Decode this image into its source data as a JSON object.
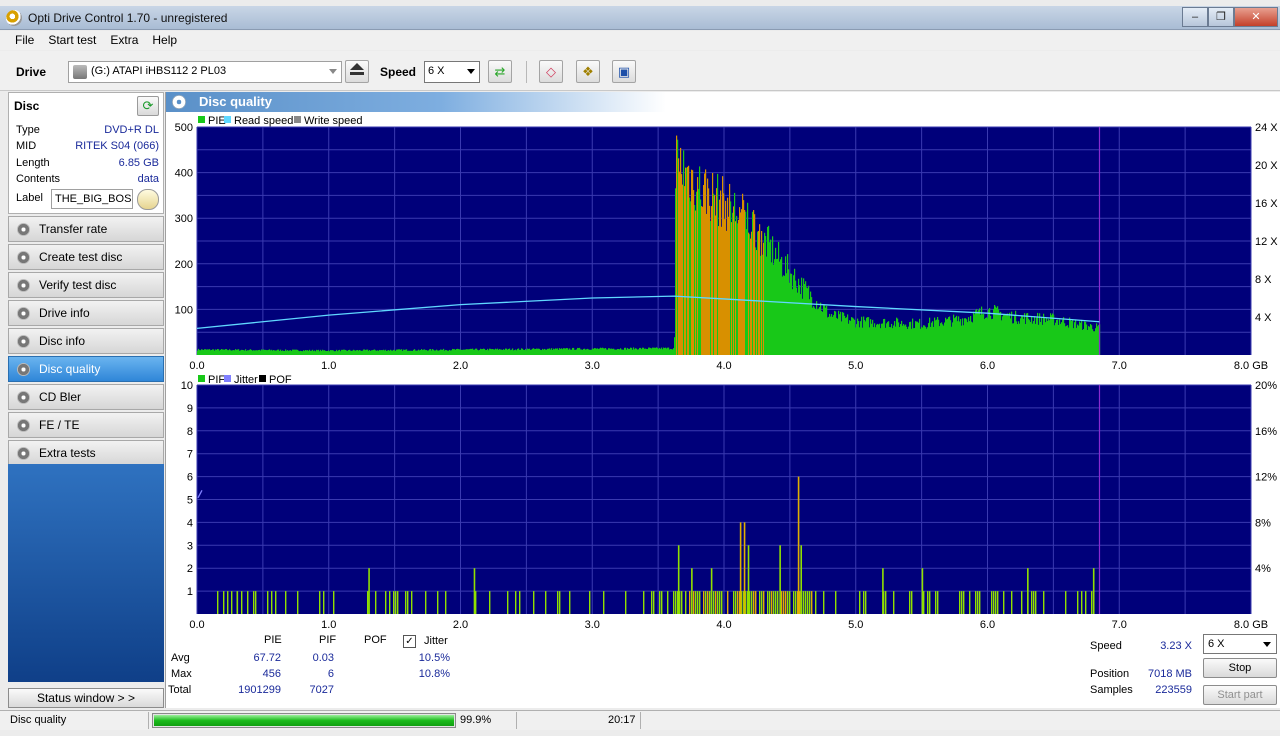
{
  "window": {
    "title": "Opti Drive Control 1.70 - unregistered",
    "min": "–",
    "max": "❐",
    "close": "✕"
  },
  "menu": [
    "File",
    "Start test",
    "Extra",
    "Help"
  ],
  "toolbar": {
    "drive_label": "Drive",
    "drive_value": "(G:)   ATAPI iHBS112   2 PL03",
    "speed_label": "Speed",
    "speed_value": "6 X"
  },
  "disc": {
    "header": "Disc",
    "type_label": "Type",
    "type_value": "DVD+R DL",
    "mid_label": "MID",
    "mid_value": "RITEK S04 (066)",
    "length_label": "Length",
    "length_value": "6.85 GB",
    "contents_label": "Contents",
    "contents_value": "data",
    "label_label": "Label",
    "label_value": "THE_BIG_BOSS"
  },
  "nav": [
    "Transfer rate",
    "Create test disc",
    "Verify test disc",
    "Drive info",
    "Disc info",
    "Disc quality",
    "CD Bler",
    "FE / TE",
    "Extra tests"
  ],
  "nav_active": "Disc quality",
  "status_window_button": "Status window > >",
  "panel_title": "Disc quality",
  "chart_data": [
    {
      "type": "bar",
      "legend": [
        "PIE",
        "Read speed",
        "Write speed"
      ],
      "colors": {
        "pie": "#18c818",
        "pie_hot": "#d89000",
        "read_speed": "#60d8ff",
        "write_speed": "#888888",
        "background": "#00007a",
        "grid": "#3a3ab0"
      },
      "x_ticks": [
        "0.0",
        "1.0",
        "2.0",
        "3.0",
        "4.0",
        "5.0",
        "6.0",
        "7.0",
        "8.0 GB"
      ],
      "y_ticks": [
        "500",
        "400",
        "300",
        "200",
        "100"
      ],
      "y2_ticks": [
        "24 X",
        "20 X",
        "16 X",
        "12 X",
        "8 X",
        "4 X"
      ],
      "xlim": [
        0,
        8
      ],
      "ylim": [
        0,
        500
      ],
      "y2lim": [
        0,
        24
      ],
      "disc_end_gb": 6.85,
      "pie_profile": [
        [
          0.0,
          12
        ],
        [
          1.0,
          10
        ],
        [
          2.0,
          12
        ],
        [
          3.0,
          14
        ],
        [
          3.62,
          15
        ],
        [
          3.63,
          440
        ],
        [
          3.8,
          380
        ],
        [
          4.0,
          340
        ],
        [
          4.2,
          300
        ],
        [
          4.4,
          220
        ],
        [
          4.6,
          150
        ],
        [
          4.8,
          90
        ],
        [
          5.0,
          75
        ],
        [
          5.5,
          70
        ],
        [
          5.8,
          80
        ],
        [
          6.0,
          100
        ],
        [
          6.2,
          85
        ],
        [
          6.5,
          80
        ],
        [
          6.85,
          60
        ]
      ],
      "pie_hot_range": [
        3.63,
        4.3
      ],
      "read_speed_x": [
        0.0,
        1.0,
        2.0,
        3.0,
        3.62,
        4.0,
        5.0,
        6.0,
        6.85
      ],
      "read_speed_y": [
        2.8,
        4.2,
        5.3,
        6.0,
        6.2,
        5.9,
        5.1,
        4.4,
        3.5
      ]
    },
    {
      "type": "bar",
      "legend": [
        "PIF",
        "Jitter",
        "POF"
      ],
      "colors": {
        "pif": "#90e000",
        "pif_hot": "#e0b000",
        "jitter": "#8080ff",
        "pof": "#000000"
      },
      "x_ticks": [
        "0.0",
        "1.0",
        "2.0",
        "3.0",
        "4.0",
        "5.0",
        "6.0",
        "7.0",
        "8.0 GB"
      ],
      "y_ticks": [
        "10",
        "9",
        "8",
        "7",
        "6",
        "5",
        "4",
        "3",
        "2",
        "1"
      ],
      "y2_ticks": [
        "20%",
        "16%",
        "12%",
        "8%",
        "4%"
      ],
      "xlim": [
        0,
        8
      ],
      "ylim": [
        0,
        10
      ],
      "y2lim": [
        0,
        20
      ],
      "pif_spikes": [
        [
          3.65,
          3
        ],
        [
          3.75,
          2
        ],
        [
          3.9,
          2
        ],
        [
          4.12,
          4
        ],
        [
          4.15,
          4
        ],
        [
          4.18,
          3
        ],
        [
          4.42,
          3
        ],
        [
          4.56,
          6
        ],
        [
          4.58,
          3
        ],
        [
          5.2,
          2
        ],
        [
          5.5,
          2
        ],
        [
          6.3,
          2
        ],
        [
          6.8,
          2
        ],
        [
          1.3,
          2
        ],
        [
          2.1,
          2
        ],
        [
          0.3,
          1
        ]
      ],
      "pif_dense_range": [
        3.62,
        4.7
      ]
    }
  ],
  "stats": {
    "col_pie": "PIE",
    "col_pif": "PIF",
    "col_pof": "POF",
    "col_jitter": "Jitter",
    "avg_label": "Avg",
    "avg_pie": "67.72",
    "avg_pif": "0.03",
    "avg_jitter": "10.5%",
    "max_label": "Max",
    "max_pie": "456",
    "max_pif": "6",
    "max_jitter": "10.8%",
    "total_label": "Total",
    "total_pie": "1901299",
    "total_pif": "7027"
  },
  "run": {
    "speed_label": "Speed",
    "speed_value": "3.23 X",
    "speed_select": "6 X",
    "stop_button": "Stop",
    "position_label": "Position",
    "position_value": "7018 MB",
    "samples_label": "Samples",
    "samples_value": "223559",
    "start_part_button": "Start part"
  },
  "statusbar": {
    "text": "Disc quality",
    "progress": 99.9,
    "progress_text": "99.9%",
    "time": "20:17"
  }
}
